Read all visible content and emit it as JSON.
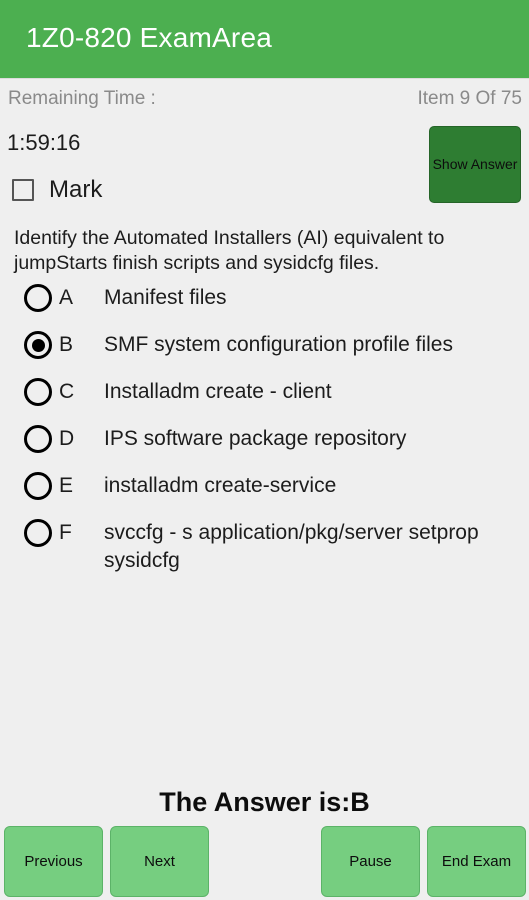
{
  "app": {
    "title": "1Z0-820 ExamArea",
    "header_color": "#4caf50",
    "background_color": "#efefef"
  },
  "info": {
    "remaining_time_label": "Remaining Time :",
    "item_counter": "Item  9  Of  75",
    "timer_value": "1:59:16"
  },
  "mark": {
    "label": "Mark",
    "checked": false
  },
  "show_answer": {
    "label": "Show Answer",
    "color": "#2e7d32"
  },
  "question": {
    "text": "Identify the Automated Installers (AI) equivalent to jumpStarts finish scripts and sysidcfg files.",
    "options": [
      {
        "letter": "A",
        "text": "Manifest files",
        "selected": false
      },
      {
        "letter": "B",
        "text": "SMF system configuration profile files",
        "selected": true
      },
      {
        "letter": "C",
        "text": "Installadm create - client",
        "selected": false
      },
      {
        "letter": "D",
        "text": "IPS software package repository",
        "selected": false
      },
      {
        "letter": "E",
        "text": "installadm create-service",
        "selected": false
      },
      {
        "letter": "F",
        "text": "svccfg - s application/pkg/server setprop sysidcfg",
        "selected": false
      }
    ]
  },
  "answer_banner": {
    "text": "The Answer is:B"
  },
  "bottom_bar": {
    "previous_label": "Previous",
    "next_label": "Next",
    "pause_label": "Pause",
    "end_exam_label": "End Exam",
    "button_color": "#76ce80"
  }
}
